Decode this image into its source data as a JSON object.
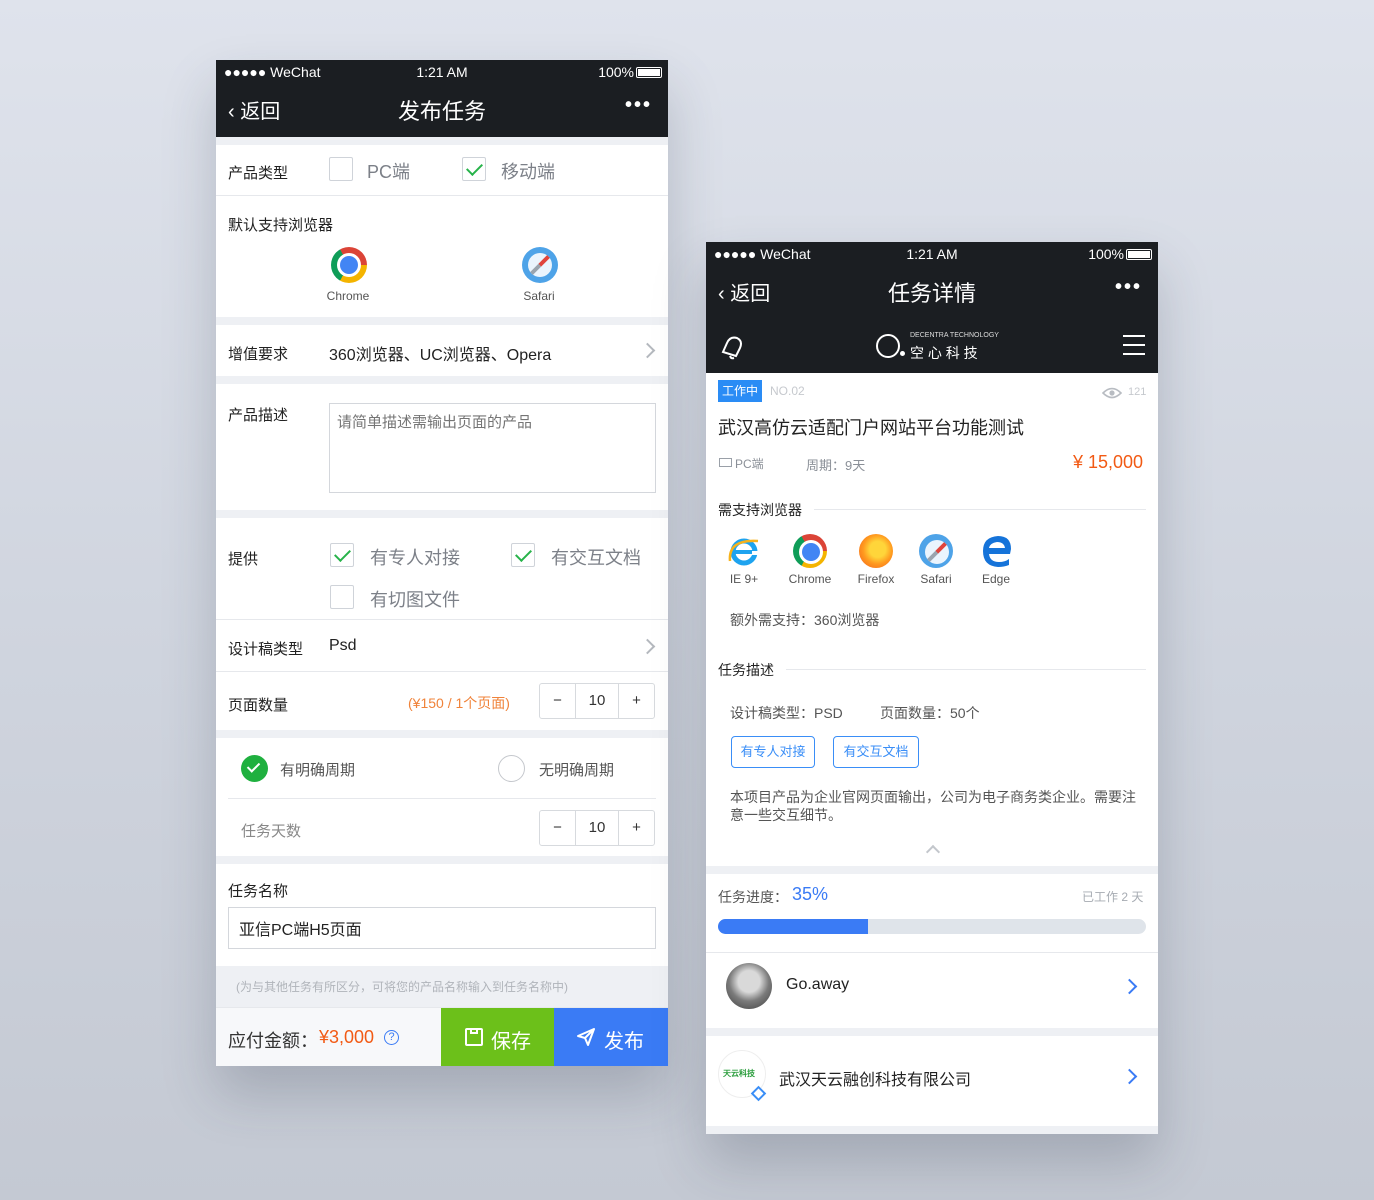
{
  "left": {
    "status": {
      "carrier": "●●●●● WeChat",
      "time": "1:21 AM",
      "battery": "100%"
    },
    "nav": {
      "back": "返回",
      "title": "发布任务",
      "more": "•••"
    },
    "product_type": {
      "label": "产品类型",
      "opt1": "PC端",
      "opt1_checked": false,
      "opt2": "移动端",
      "opt2_checked": true
    },
    "default_browsers": {
      "label": "默认支持浏览器",
      "items": [
        {
          "name": "Chrome",
          "icon": "chrome-icon"
        },
        {
          "name": "Safari",
          "icon": "safari-icon"
        }
      ]
    },
    "value_added": {
      "label": "增值要求",
      "value": "360浏览器、UC浏览器、Opera"
    },
    "description": {
      "label": "产品描述",
      "placeholder": "请简单描述需输出页面的产品"
    },
    "provide": {
      "label": "提供",
      "opt1": "有专人对接",
      "opt1_checked": true,
      "opt2": "有交互文档",
      "opt2_checked": true,
      "opt3": "有切图文件",
      "opt3_checked": false
    },
    "design_type": {
      "label": "设计稿类型",
      "value": "Psd"
    },
    "page_count": {
      "label": "页面数量",
      "price_hint": "(¥150 / 1个页面)",
      "value": "10",
      "minus": "−",
      "plus": "+"
    },
    "period": {
      "opt1": "有明确周期",
      "opt1_selected": true,
      "opt2": "无明确周期",
      "opt2_selected": false
    },
    "task_days": {
      "label": "任务天数",
      "value": "10",
      "minus": "−",
      "plus": "+"
    },
    "task_name": {
      "label": "任务名称",
      "value": "亚信PC端H5页面",
      "hint": "(为与其他任务有所区分，可将您的产品名称输入到任务名称中)"
    },
    "footer": {
      "amount_label": "应付金额：",
      "amount": "¥3,000",
      "help": "?",
      "save": "保存",
      "publish": "发布"
    }
  },
  "right": {
    "status": {
      "carrier": "●●●●● WeChat",
      "time": "1:21 AM",
      "battery": "100%"
    },
    "nav": {
      "back": "返回",
      "title": "任务详情",
      "more": "•••"
    },
    "brand": {
      "tagline": "DECENTRA TECHNOLOGY",
      "name": "空 心 科 技"
    },
    "task": {
      "status": "工作中",
      "no": "NO.02",
      "views": "121",
      "title": "武汉高仿云适配门户网站平台功能测试",
      "platform": "PC端",
      "period": "周期：9天",
      "price": "¥ 15,000"
    },
    "browsers": {
      "heading": "需支持浏览器",
      "items": [
        {
          "name": "IE 9+",
          "icon": "ie-icon"
        },
        {
          "name": "Chrome",
          "icon": "chrome-icon"
        },
        {
          "name": "Firefox",
          "icon": "firefox-icon"
        },
        {
          "name": "Safari",
          "icon": "safari-icon"
        },
        {
          "name": "Edge",
          "icon": "edge-icon"
        }
      ],
      "extra": "额外需支持：360浏览器"
    },
    "desc": {
      "heading": "任务描述",
      "design": "设计稿类型：PSD",
      "pages": "页面数量：50个",
      "tag1": "有专人对接",
      "tag2": "有交互文档",
      "text": "本项目产品为企业官网页面输出，公司为电子商务类企业。需要注意一些交互细节。"
    },
    "progress": {
      "label": "任务进度：",
      "value": "35%",
      "fraction": 0.35,
      "worked": "已工作 2 天"
    },
    "assignee": {
      "name": "Go.away"
    },
    "company": {
      "name": "武汉天云融创科技有限公司",
      "logo_text": "天云科技"
    }
  },
  "colors": {
    "green": "#6cc01a",
    "blue": "#3a7bf5",
    "orange": "#f25a14",
    "nav_bg": "#1b1e22"
  }
}
